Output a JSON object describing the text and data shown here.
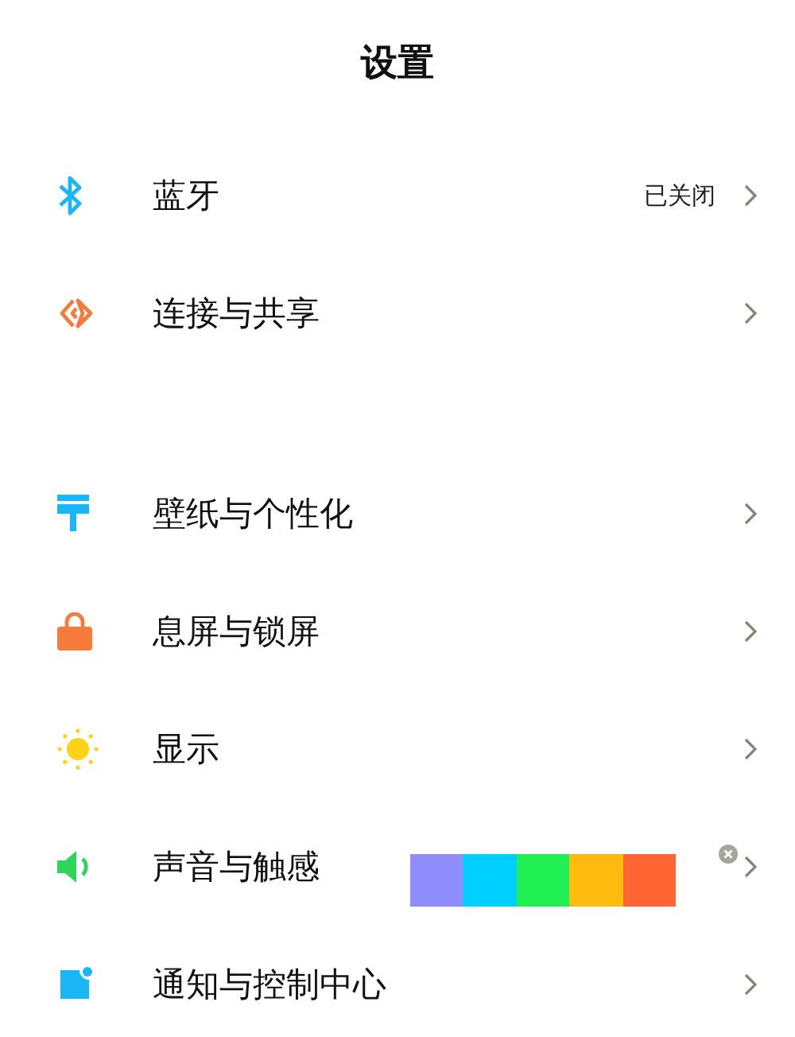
{
  "header": {
    "title": "设置"
  },
  "groups": [
    {
      "items": [
        {
          "label": "蓝牙",
          "status": "已关闭"
        },
        {
          "label": "连接与共享"
        }
      ]
    },
    {
      "items": [
        {
          "label": "壁纸与个性化"
        },
        {
          "label": "息屏与锁屏"
        },
        {
          "label": "显示"
        },
        {
          "label": "声音与触感"
        },
        {
          "label": "通知与控制中心"
        }
      ]
    }
  ],
  "color_strip": {
    "swatches": [
      {
        "color": "#8f8cfb"
      },
      {
        "color": "#00d0ff"
      },
      {
        "color": "#1fef52"
      },
      {
        "color": "#ffbb0f"
      },
      {
        "color": "#ff6633"
      }
    ]
  }
}
